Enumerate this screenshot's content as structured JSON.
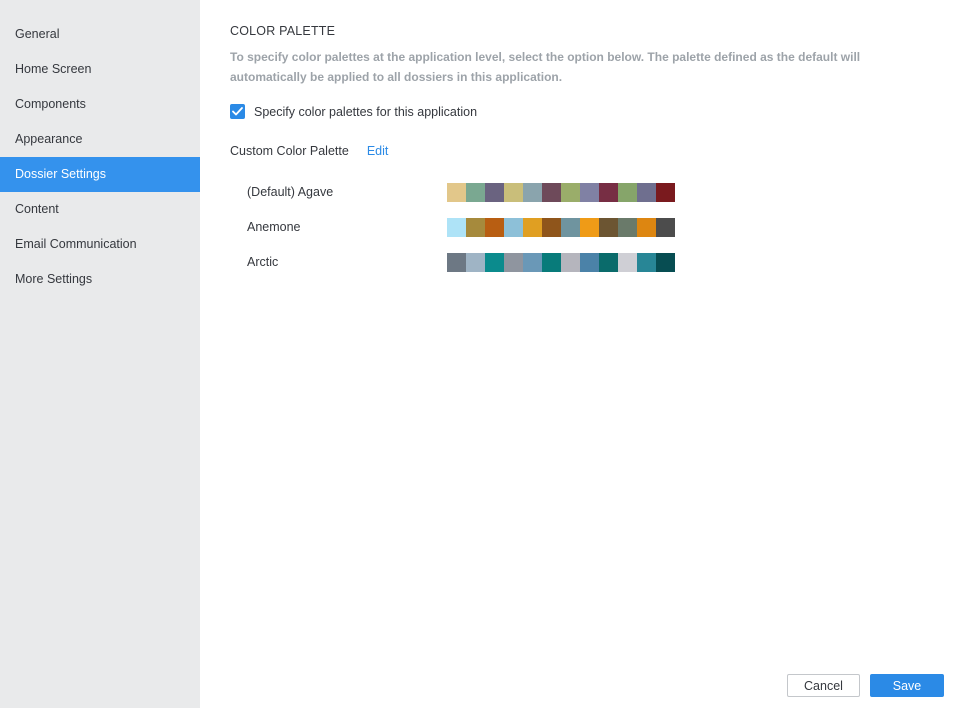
{
  "sidebar": {
    "items": [
      {
        "label": "General"
      },
      {
        "label": "Home Screen"
      },
      {
        "label": "Components"
      },
      {
        "label": "Appearance"
      },
      {
        "label": "Dossier Settings",
        "active": true
      },
      {
        "label": "Content"
      },
      {
        "label": "Email Communication"
      },
      {
        "label": "More Settings"
      }
    ]
  },
  "main": {
    "section_title": "COLOR PALETTE",
    "description": "To specify color palettes at the application level, select the option below. The palette defined as the default will automatically be applied to all dossiers in this application.",
    "checkbox_label": "Specify color palettes for this application",
    "checkbox_checked": true,
    "custom_palette_label": "Custom Color Palette",
    "edit_label": "Edit",
    "palettes": [
      {
        "name": "(Default) Agave",
        "colors": [
          "#e2c78a",
          "#7aa891",
          "#6a6380",
          "#c9be7a",
          "#8aa4ad",
          "#6e4a5a",
          "#9aad6a",
          "#8081a4",
          "#772e44",
          "#86a56a",
          "#6f6f8f",
          "#7a1a1e"
        ]
      },
      {
        "name": "Anemone",
        "colors": [
          "#aee3f7",
          "#a68a3c",
          "#b85e12",
          "#8dc0d8",
          "#e09f22",
          "#8f551b",
          "#6f949f",
          "#ef9b17",
          "#6c5532",
          "#6a7a6a",
          "#dd8611",
          "#4c4c4c"
        ]
      },
      {
        "name": "Arctic",
        "colors": [
          "#6d7884",
          "#9fb4c5",
          "#0b8b8d",
          "#8f959f",
          "#6a98b7",
          "#087b7a",
          "#b5b5bd",
          "#4b82a8",
          "#0a6b6b",
          "#cfcfd5",
          "#288696",
          "#074d52"
        ]
      }
    ]
  },
  "footer": {
    "cancel_label": "Cancel",
    "save_label": "Save"
  },
  "colors": {
    "accent": "#2b8ae6",
    "sidebar_active": "#3492ed",
    "sidebar_bg": "#e9eaeb"
  },
  "icons": {
    "checkbox": "check-icon"
  }
}
